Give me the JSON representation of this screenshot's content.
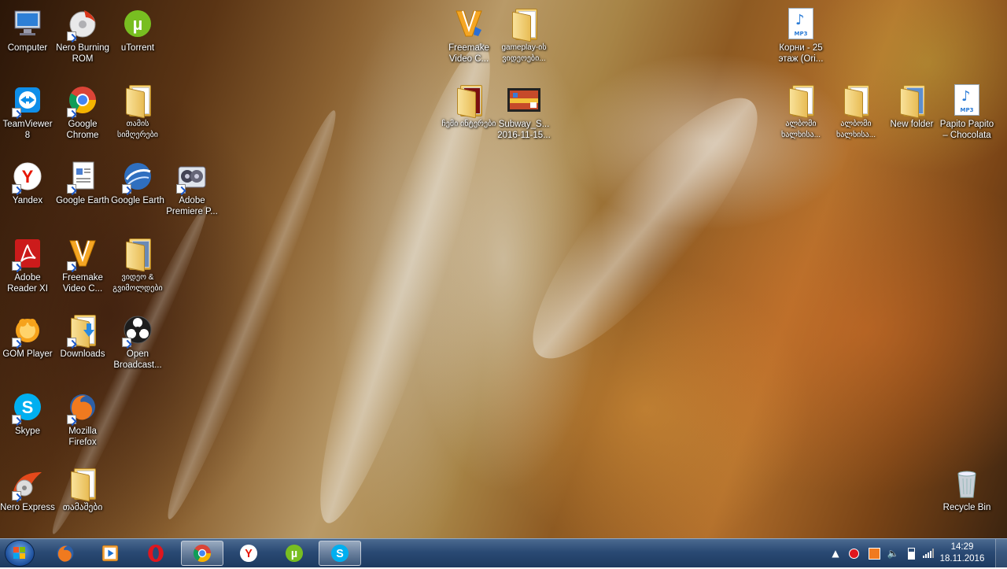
{
  "desktop": {
    "icons": [
      {
        "label": "Computer",
        "icon": "computer-icon"
      },
      {
        "label": "Nero Burning ROM",
        "icon": "nero-burning-rom-icon"
      },
      {
        "label": "uTorrent",
        "icon": "utorrent-icon"
      },
      {
        "label": "TeamViewer 8",
        "icon": "teamviewer-icon"
      },
      {
        "label": "Google Chrome",
        "icon": "chrome-icon"
      },
      {
        "label": "თამის სიმღერები",
        "icon": "folder-icon"
      },
      {
        "label": "Yandex",
        "icon": "yandex-icon"
      },
      {
        "label": "Google Earth",
        "icon": "document-icon"
      },
      {
        "label": "Google Earth",
        "icon": "google-earth-icon"
      },
      {
        "label": "Adobe Premiere P...",
        "icon": "premiere-icon"
      },
      {
        "label": "Adobe Reader XI",
        "icon": "adobe-reader-icon"
      },
      {
        "label": "Freemake Video C...",
        "icon": "freemake-icon"
      },
      {
        "label": "ვიდეო & გვიმოლდები",
        "icon": "folder-icon"
      },
      {
        "label": "GOM Player",
        "icon": "gom-player-icon"
      },
      {
        "label": "Downloads",
        "icon": "downloads-folder-icon"
      },
      {
        "label": "Open Broadcast...",
        "icon": "obs-icon"
      },
      {
        "label": "Skype",
        "icon": "skype-icon"
      },
      {
        "label": "Mozilla Firefox",
        "icon": "firefox-icon"
      },
      {
        "label": "Nero Express",
        "icon": "nero-express-icon"
      },
      {
        "label": "თამაშები",
        "icon": "folder-icon"
      },
      {
        "label": "Freemake Video C...",
        "icon": "freemake-icon"
      },
      {
        "label": "gameplay-ის ვიდეოები...",
        "icon": "folder-icon"
      },
      {
        "label": "ჩემი ინტერები",
        "icon": "folder-icon"
      },
      {
        "label": "Subway_S... 2016-11-15...",
        "icon": "video-file-icon"
      },
      {
        "label": "Корни - 25 этаж (Ori...",
        "icon": "mp3-file-icon"
      },
      {
        "label": "ალბომი ხალხისა...",
        "icon": "folder-icon"
      },
      {
        "label": "ალბომი ხალხისა...",
        "icon": "folder-icon"
      },
      {
        "label": "New folder",
        "icon": "folder-icon"
      },
      {
        "label": "Papito Papito – Chocolata",
        "icon": "mp3-file-icon"
      },
      {
        "label": "Recycle Bin",
        "icon": "recycle-bin-icon"
      }
    ]
  },
  "taskbar": {
    "pinned": [
      {
        "name": "firefox",
        "icon": "firefox-icon"
      },
      {
        "name": "media-player",
        "icon": "media-player-icon"
      },
      {
        "name": "opera",
        "icon": "opera-icon"
      },
      {
        "name": "chrome",
        "icon": "chrome-icon",
        "active": true
      },
      {
        "name": "yandex",
        "icon": "yandex-icon"
      },
      {
        "name": "utorrent",
        "icon": "utorrent-icon"
      },
      {
        "name": "skype",
        "icon": "skype-icon"
      }
    ],
    "tray": [
      "show-hidden-icon",
      "record-icon",
      "app-tray-icon",
      "volume-icon",
      "battery-icon",
      "network-icon"
    ],
    "clock": {
      "time": "14:29",
      "date": "18.11.2016"
    }
  },
  "colors": {
    "taskbar": "#2a4a74",
    "label_text": "#ffffff"
  }
}
